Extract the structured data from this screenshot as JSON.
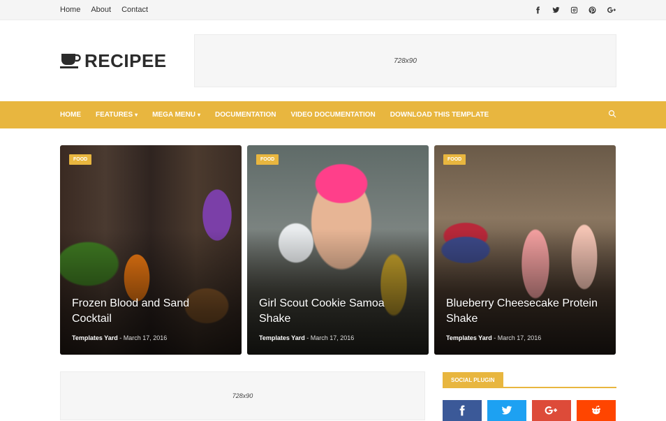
{
  "topbar": {
    "links": [
      "Home",
      "About",
      "Contact"
    ],
    "social_icons": [
      "facebook-icon",
      "twitter-icon",
      "instagram-icon",
      "pinterest-icon",
      "google-plus-icon"
    ]
  },
  "header": {
    "logo_text": "RECIPEE",
    "ad_label": "728x90"
  },
  "nav": {
    "items": [
      {
        "label": "HOME",
        "dropdown": false
      },
      {
        "label": "FEATURES",
        "dropdown": true
      },
      {
        "label": "MEGA MENU",
        "dropdown": true
      },
      {
        "label": "DOCUMENTATION",
        "dropdown": false
      },
      {
        "label": "VIDEO DOCUMENTATION",
        "dropdown": false
      },
      {
        "label": "DOWNLOAD THIS TEMPLATE",
        "dropdown": false
      }
    ],
    "chevron": "▾",
    "search_icon": "search-icon"
  },
  "featured": [
    {
      "tag": "FOOD",
      "title": "Frozen Blood and Sand Cocktail",
      "author": "Templates Yard",
      "sep": " - ",
      "date": "March 17, 2016"
    },
    {
      "tag": "FOOD",
      "title": "Girl Scout Cookie Samoa Shake",
      "author": "Templates Yard",
      "sep": " - ",
      "date": "March 17, 2016"
    },
    {
      "tag": "FOOD",
      "title": "Blueberry Cheesecake Protein Shake",
      "author": "Templates Yard",
      "sep": " - ",
      "date": "March 17, 2016"
    }
  ],
  "content_ad": {
    "label": "728x90"
  },
  "sidebar": {
    "widget_title": "SOCIAL PLUGIN",
    "buttons": [
      {
        "icon": "facebook-icon",
        "color": "#3b5998"
      },
      {
        "icon": "twitter-icon",
        "color": "#1da1f2"
      },
      {
        "icon": "google-plus-icon",
        "color": "#dd4b39"
      },
      {
        "icon": "reddit-icon",
        "color": "#ff4500"
      }
    ]
  },
  "colors": {
    "accent": "#e8b63f"
  }
}
